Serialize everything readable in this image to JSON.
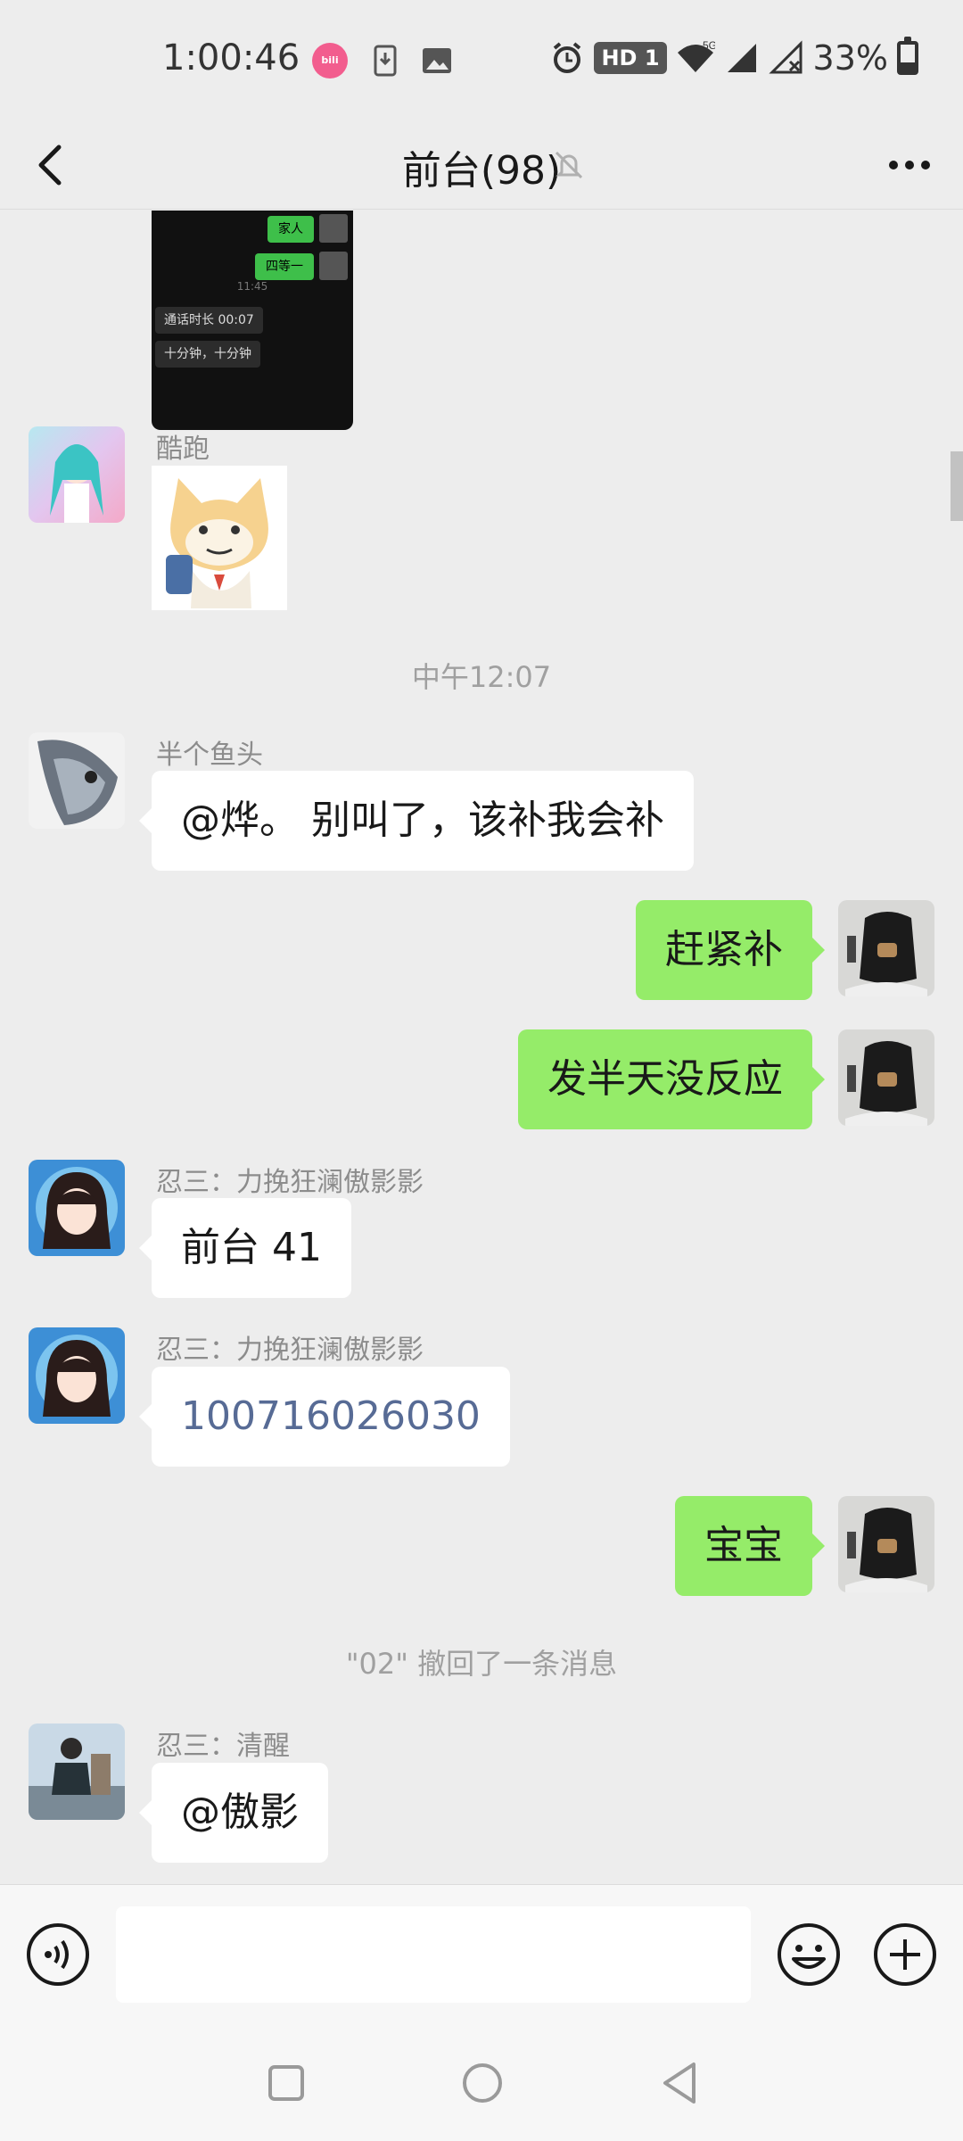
{
  "status_bar": {
    "time": "1:00:46",
    "bilibili_icon_text": "bili",
    "hd_badge": "HD 1",
    "network": "5G",
    "battery_text": "33%",
    "battery_level": 0.33,
    "icons": [
      "bilibili-icon",
      "download-icon",
      "gallery-icon",
      "alarm-icon",
      "wifi-icon",
      "signal-icon",
      "no-signal-icon",
      "battery-icon"
    ]
  },
  "header": {
    "title": "前台(98)",
    "icons": [
      "back-arrow-icon",
      "mute-bell-icon",
      "more-dots-icon"
    ]
  },
  "screenshot_image": {
    "green_1": "家人",
    "green_2": "四等一",
    "time": "11:45",
    "dark_1": "通话时长 00:07",
    "dark_2": "十分钟，十分钟"
  },
  "messages": {
    "m1_sender": "酷跑",
    "time_sep": "中午12:07",
    "m2_sender": "半个鱼头",
    "m2_text": "@烨。 别叫了，该补我会补",
    "m3_text": "赶紧补",
    "m4_text": "发半天没反应",
    "m5_sender": "忍三：力挽狂澜傲影影",
    "m5_text": "前台 41",
    "m6_sender": "忍三：力挽狂澜傲影影",
    "m6_text": "100716026030",
    "m7_text": "宝宝",
    "recall_notice": "\"02\" 撤回了一条消息",
    "m8_sender": "忍三：清醒",
    "m8_text": "@傲影"
  },
  "input_bar": {
    "value": "",
    "icons": [
      "voice-icon",
      "emoji-icon",
      "plus-icon"
    ]
  },
  "nav_bar": {
    "icons": [
      "recents-square-icon",
      "home-circle-icon",
      "back-triangle-icon"
    ]
  },
  "colors": {
    "background": "#ededed",
    "self_bubble": "#95ec69",
    "other_bubble": "#ffffff",
    "link_text": "#576b95"
  }
}
